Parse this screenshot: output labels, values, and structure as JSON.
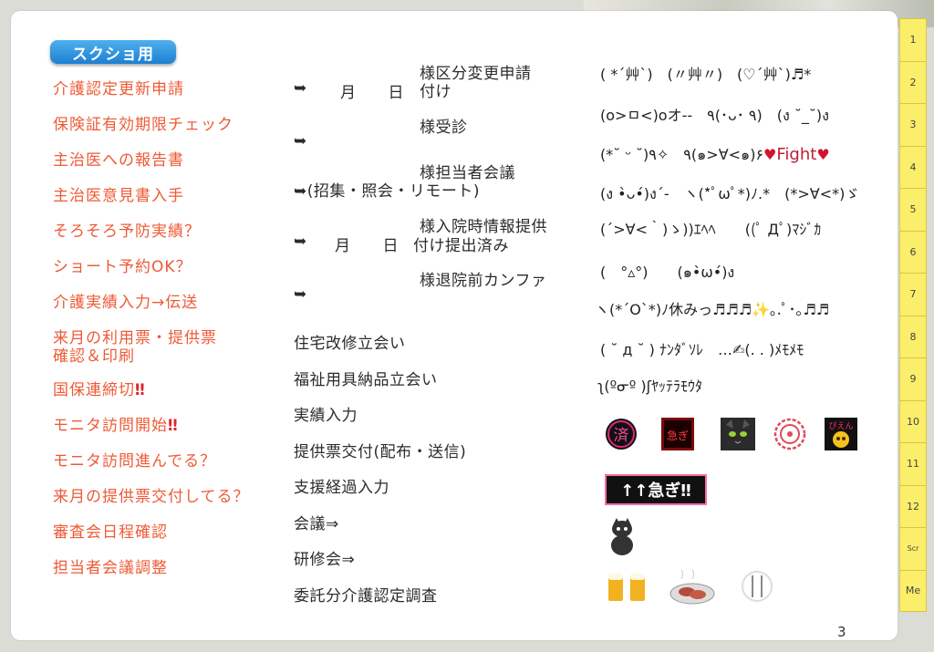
{
  "badge": "スクショ用",
  "todo": [
    {
      "text": "介護認定更新申請",
      "mark": ""
    },
    {
      "text": "保険証有効期限チェック",
      "mark": ""
    },
    {
      "text": "主治医への報告書",
      "mark": ""
    },
    {
      "text": "主治医意見書入手",
      "mark": ""
    },
    {
      "text": "そろそろ予防実績？",
      "mark": ""
    },
    {
      "text": "ショート予約OK？",
      "mark": ""
    },
    {
      "text": "介護実績入力→伝送",
      "mark": ""
    },
    {
      "text": "来月の利用票・提供票\n確認＆印刷",
      "mark": ""
    },
    {
      "text": "国保連締切",
      "mark": "‼"
    },
    {
      "text": "モニタ訪問開始",
      "mark": "‼"
    },
    {
      "text": "モニタ訪問進んでる？",
      "mark": ""
    },
    {
      "text": "来月の提供票交付してる？",
      "mark": ""
    },
    {
      "text": "審査会日程確認",
      "mark": ""
    },
    {
      "text": "担当者会議調整",
      "mark": ""
    }
  ],
  "templates": {
    "t1_arrow": "➥",
    "t1_date": "月　　日",
    "t1_title": "様区分変更申請",
    "t1_sub": "付け",
    "t2_arrow": "➥",
    "t2_title": "様受診",
    "t3_title": "様担当者会議",
    "t3_line": "➥(招集・照会・リモート)",
    "t4_arrow": "➥",
    "t4_date": "月　　日",
    "t4_title": "様入院時情報提供",
    "t4_sub": "付け提出済み",
    "t5_arrow": "➥",
    "t5_title": "様退院前カンファ",
    "items": [
      "住宅改修立会い",
      "福祉用具納品立会い",
      "実績入力",
      "提供票交付(配布・送信)",
      "支援経過入力",
      "会議⇒",
      "研修会⇒",
      "委託分介護認定調査"
    ]
  },
  "kaomoji": [
    "( *´艸`)　(〃艸〃)　(♡´艸`)♬*",
    "(o>ㅁ<)oオ--　٩(･ᴗ･ ٩)　(ง ˘_˘)ง",
    "(*˘ ᵕ ˘)٩　✧٩(๑>∀<๑)۶",
    "(ง •̀ᴗ•́)ง´-　ヽ(*ﾟωﾟ*)ﾉ.*　(*>∀<*)ゞ",
    "(´>∀<｀)ゝ))ｴﾍﾍ　　((ﾟ Дﾟ)ﾏｼﾞｶ",
    "(　°▵°)　　(๑•̀ω•́)ง",
    "ヽ(*´O`*)ﾉ休みっ♬♬♬✨｡.ﾟ･｡♬♬",
    "( ˘ д ˘ ) ﾅﾝﾀﾞｿﾚ　…✍(. . )ﾒﾓﾒﾓ",
    "ʅ(ºᓂº )ʃﾔｯﾃﾗﾓｳﾀ"
  ],
  "fight_word": "Fight",
  "stickers": {
    "s1": "済",
    "s2": "急ぎ",
    "s5": "ぴえん",
    "banner": "↑↑急ぎ‼"
  },
  "tabs": [
    "1",
    "2",
    "3",
    "4",
    "5",
    "6",
    "7",
    "8",
    "9",
    "10",
    "11",
    "12",
    "Scr",
    "Me"
  ],
  "page_number": "3",
  "colors": {
    "todo": "#ee5a36",
    "tab": "#fbee6a",
    "badge": "#2b8de0"
  }
}
